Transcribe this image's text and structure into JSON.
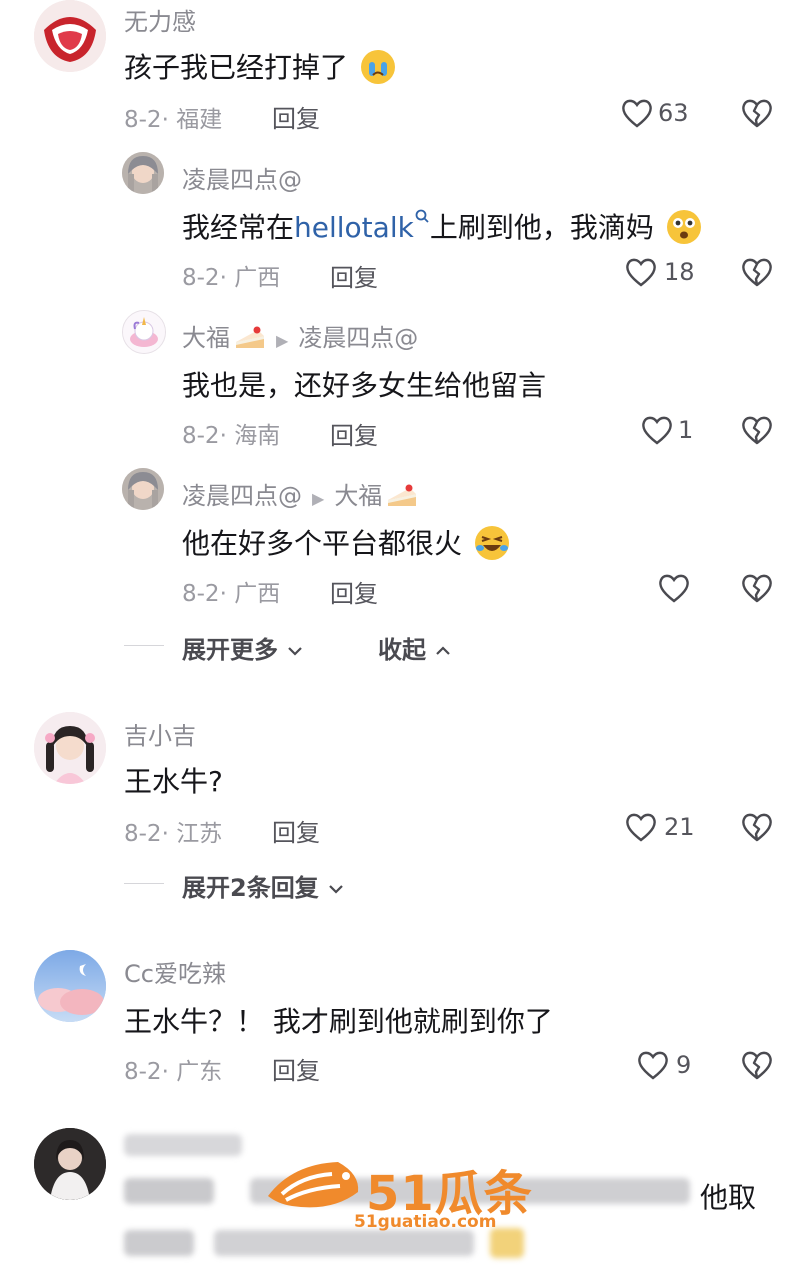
{
  "comments": [
    {
      "username": "无力感",
      "text": "孩子我已经打掉了",
      "date": "8-2",
      "location": "福建",
      "reply_label": "回复",
      "likes": "63"
    },
    {
      "username": "凌晨四点@",
      "text_before": "我经常在",
      "text_link": "hellotalk",
      "text_after": "上刷到他，我滴妈",
      "date": "8-2",
      "location": "广西",
      "reply_label": "回复",
      "likes": "18"
    },
    {
      "username": "大福",
      "reply_to": "凌晨四点@",
      "text": "我也是，还好多女生给他留言",
      "date": "8-2",
      "location": "海南",
      "reply_label": "回复",
      "likes": "1"
    },
    {
      "username": "凌晨四点@",
      "reply_to": "大福",
      "text": "他在好多个平台都很火",
      "date": "8-2",
      "location": "广西",
      "reply_label": "回复",
      "likes": ""
    },
    {
      "username": "吉小吉",
      "text": "王水牛?",
      "date": "8-2",
      "location": "江苏",
      "reply_label": "回复",
      "likes": "21"
    },
    {
      "username": "Cc爱吃辣",
      "text": "王水牛？！ 我才刷到他就刷到你了",
      "date": "8-2",
      "location": "广东",
      "reply_label": "回复",
      "likes": "9"
    }
  ],
  "expand_more": "展开更多",
  "collapse": "收起",
  "expand_replies": "展开2条回复",
  "blurred_tail": "他取",
  "watermark": {
    "brand": "51瓜条",
    "url": "51guatiao.com"
  },
  "colors": {
    "link": "#2f62a8",
    "watermark": "#f08a2c",
    "secondary_text": "#9a9aa1"
  },
  "icons": [
    "heart-icon",
    "broken-heart-icon",
    "search-icon",
    "chevron-down-icon",
    "chevron-up-icon",
    "triangle-right-icon"
  ]
}
